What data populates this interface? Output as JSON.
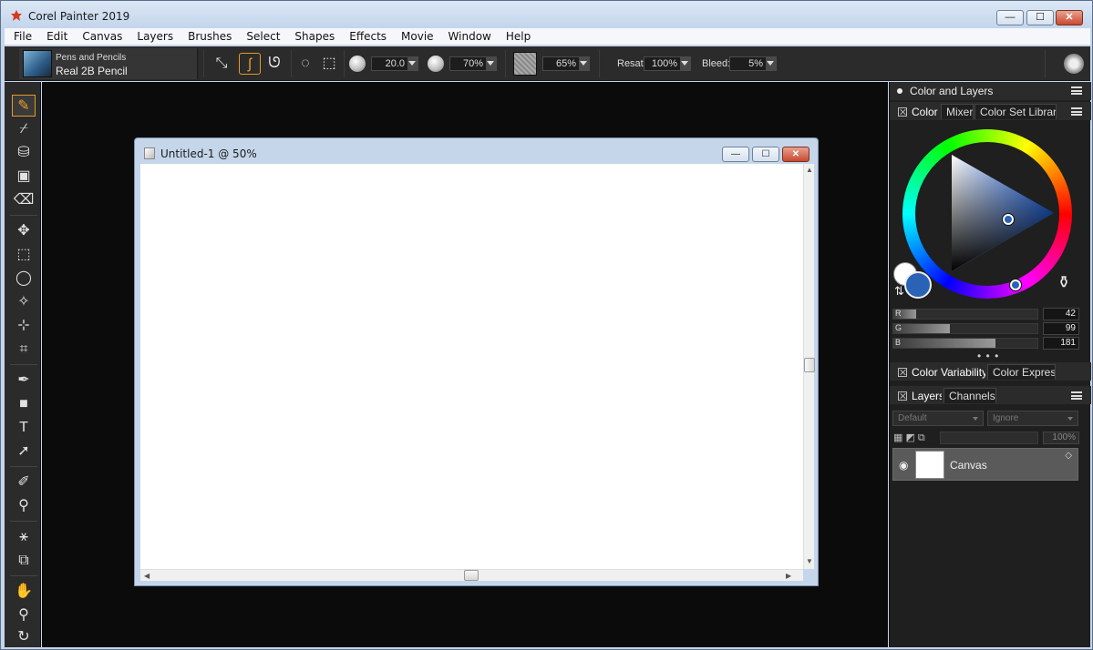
{
  "app": {
    "title": "Corel Painter 2019",
    "window_controls": {
      "minimize": "—",
      "maximize": "☐",
      "close": "✕"
    }
  },
  "menu": [
    "File",
    "Edit",
    "Canvas",
    "Layers",
    "Brushes",
    "Select",
    "Shapes",
    "Effects",
    "Movie",
    "Window",
    "Help"
  ],
  "property_bar": {
    "brush_category": "Pens and Pencils",
    "brush_variant": "Real 2B Pencil",
    "size": "20.0",
    "opacity": "70%",
    "grain": "65%",
    "resat_label": "Resat:",
    "resat": "100%",
    "bleed_label": "Bleed:",
    "bleed": "5%"
  },
  "document": {
    "title": "Untitled-1 @ 50%",
    "window_controls": {
      "minimize": "—",
      "maximize": "☐",
      "close": "✕"
    }
  },
  "panel": {
    "title": "Color and Layers",
    "color_tabs": [
      "Color",
      "Mixer",
      "Color Set Libraries"
    ],
    "rgb": [
      {
        "label": "R",
        "value": "42",
        "level": 0.16
      },
      {
        "label": "G",
        "value": "99",
        "level": 0.39
      },
      {
        "label": "B",
        "value": "181",
        "level": 0.71
      }
    ],
    "current_color": "#2a63b5",
    "more": "• • •",
    "variability_tabs": [
      "Color Variability",
      "Color Express"
    ],
    "layers_tabs": [
      "Layers",
      "Channels"
    ],
    "composite_method": "Default",
    "preserve": "Ignore",
    "opacity": "100%",
    "layer_name": "Canvas"
  }
}
